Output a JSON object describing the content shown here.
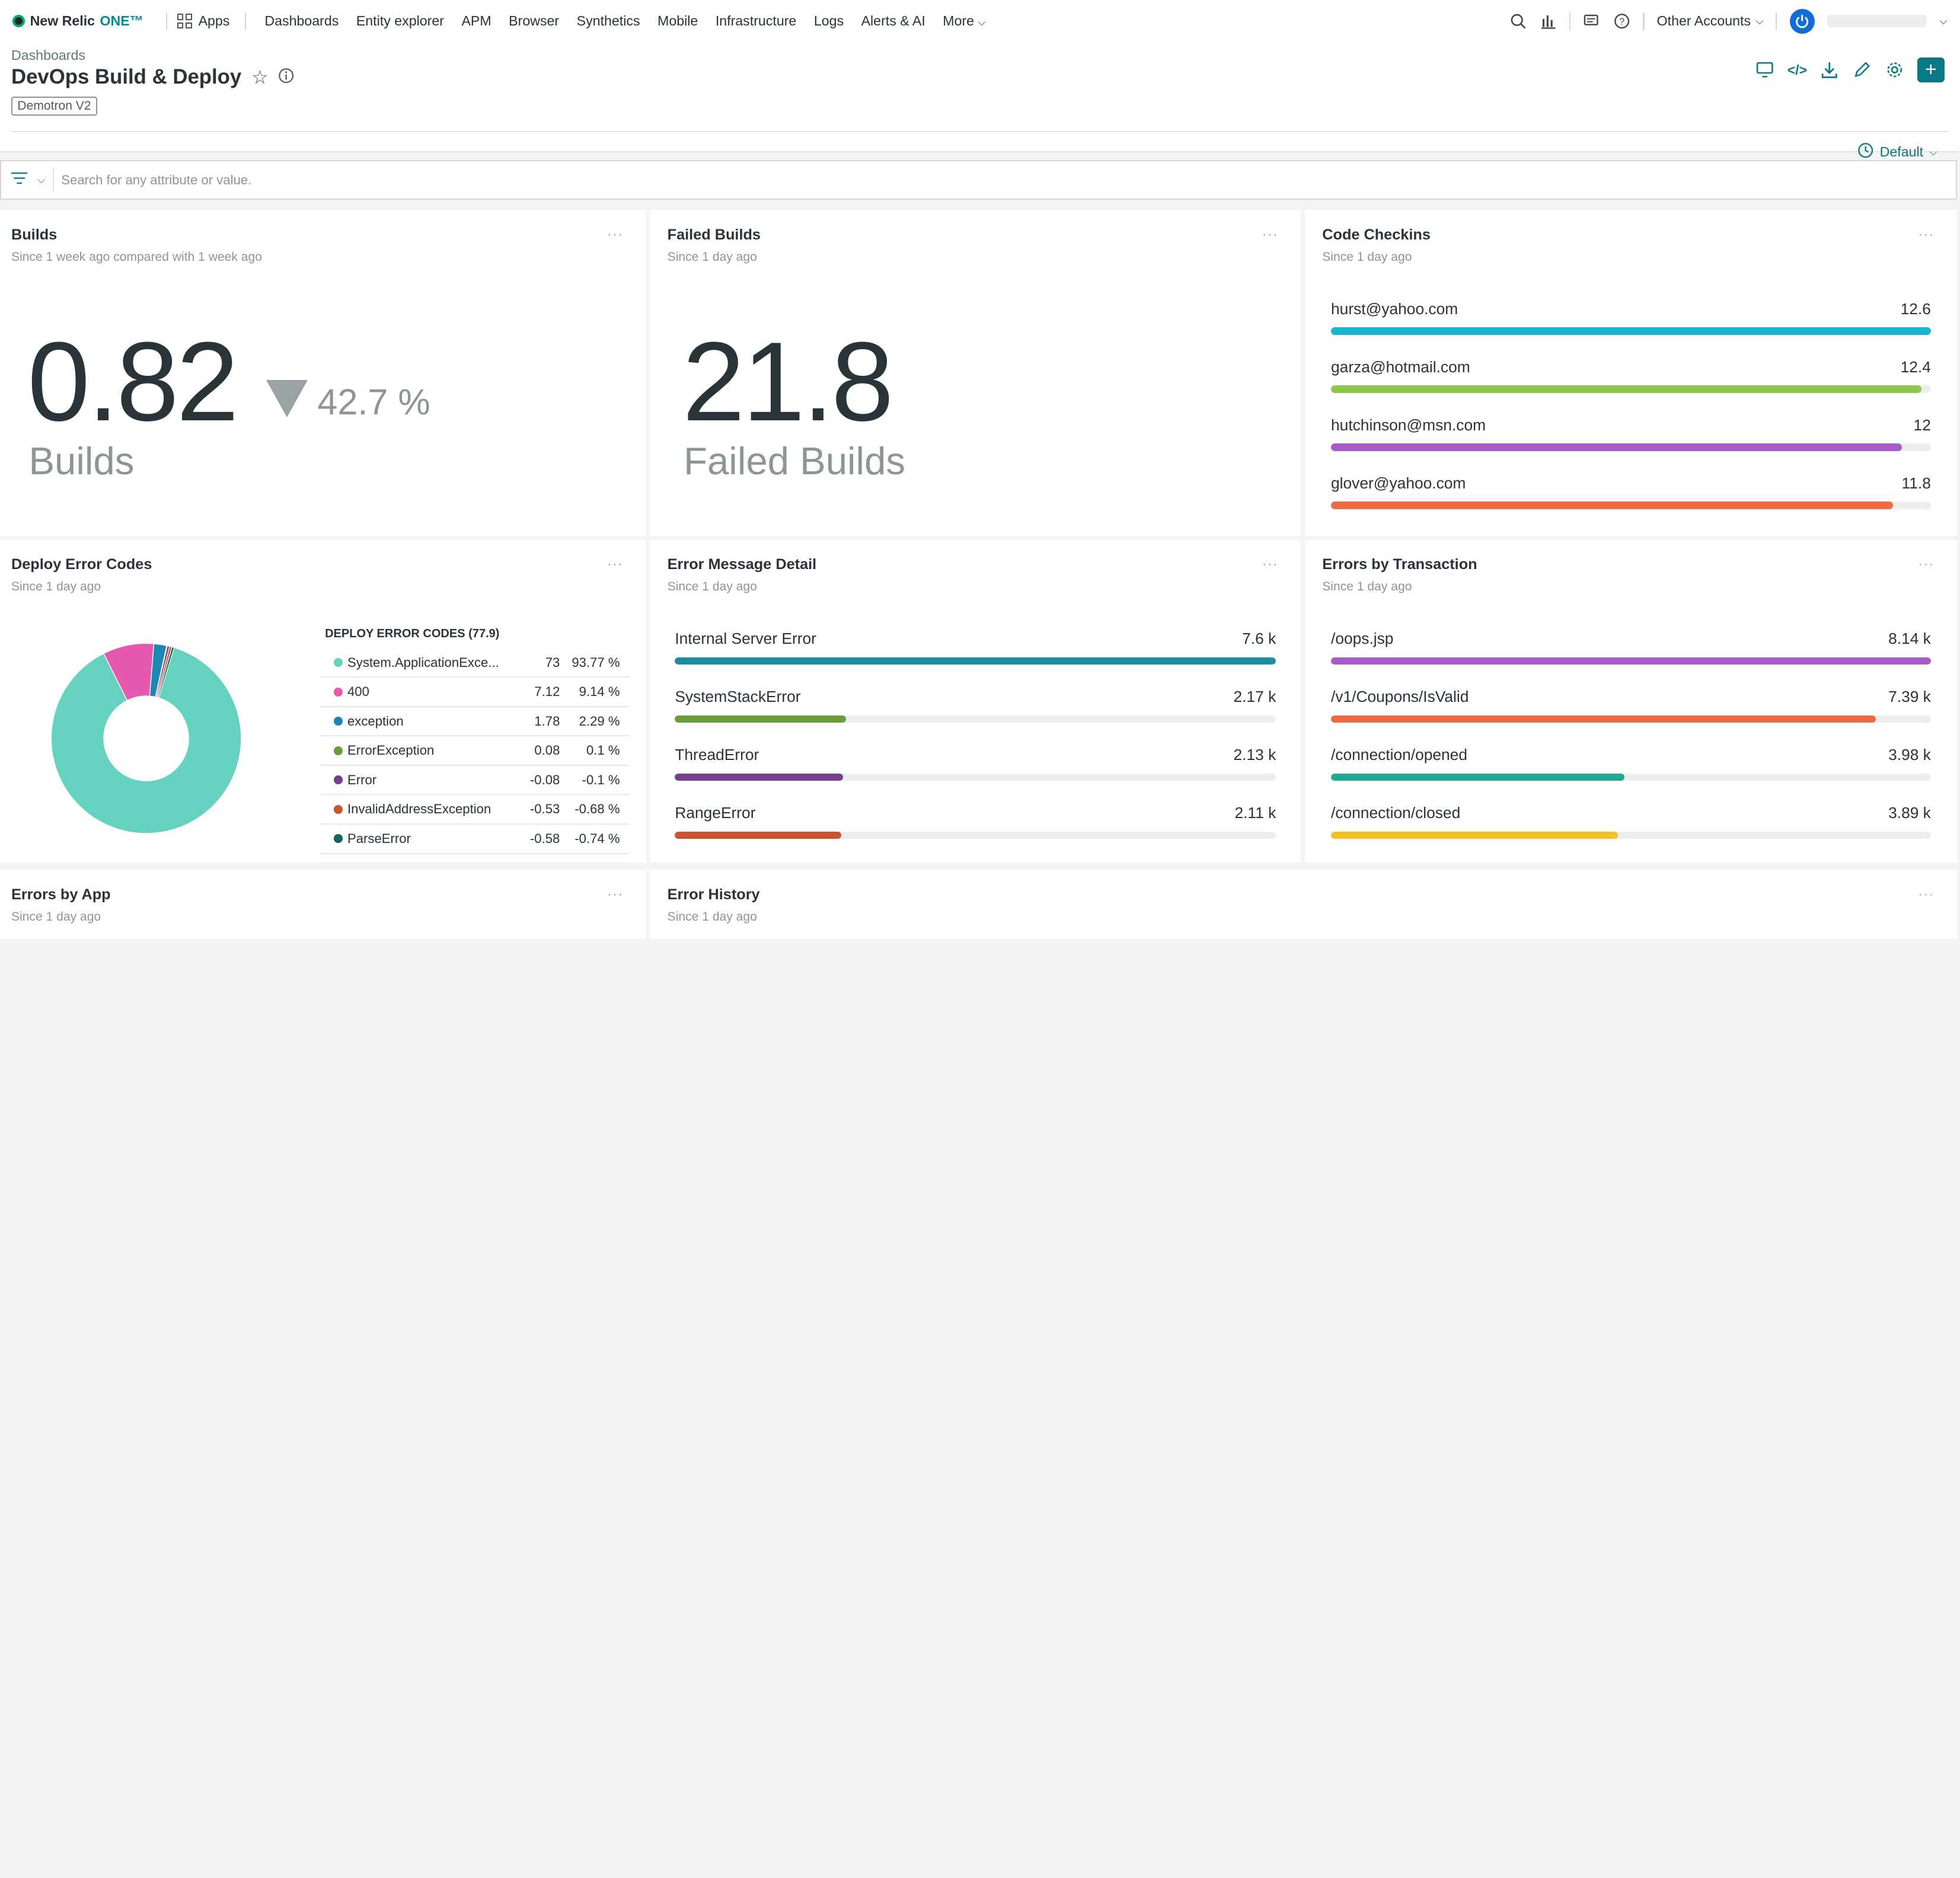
{
  "nav": {
    "logo_text": "New Relic",
    "logo_one": "ONE™",
    "apps_label": "Apps",
    "items": [
      "Dashboards",
      "Entity explorer",
      "APM",
      "Browser",
      "Synthetics",
      "Mobile",
      "Infrastructure",
      "Logs",
      "Alerts & AI",
      "More"
    ],
    "account_label": "Other Accounts"
  },
  "header": {
    "breadcrumb": "Dashboards",
    "title": "DevOps Build & Deploy",
    "tag": "Demotron V2",
    "time_label": "Default"
  },
  "filter": {
    "placeholder": "Search for any attribute or value."
  },
  "widgets": {
    "builds": {
      "title": "Builds",
      "subtitle": "Since 1 week ago compared with 1 week ago",
      "value": "0.82",
      "label": "Builds",
      "change": "42.7 %"
    },
    "failed": {
      "title": "Failed Builds",
      "subtitle": "Since 1 day ago",
      "value": "21.8",
      "label": "Failed Builds"
    },
    "checkins": {
      "title": "Code Checkins",
      "subtitle": "Since 1 day ago",
      "rows": [
        {
          "label": "hurst@yahoo.com",
          "value": "12.6",
          "fill": 1.0,
          "color": "#1ab4d3"
        },
        {
          "label": "garza@hotmail.com",
          "value": "12.4",
          "fill": 0.984,
          "color": "#8cc94a"
        },
        {
          "label": "hutchinson@msn.com",
          "value": "12",
          "fill": 0.952,
          "color": "#a65bc9"
        },
        {
          "label": "glover@yahoo.com",
          "value": "11.8",
          "fill": 0.937,
          "color": "#f06a3f"
        }
      ]
    },
    "deploy": {
      "title": "Deploy Error Codes",
      "subtitle": "Since 1 day ago",
      "table_title": "DEPLOY ERROR CODES (77.9)",
      "rows": [
        {
          "name": "System.ApplicationExce...",
          "v": "73",
          "p": "93.77 %",
          "color": "#65d2bf"
        },
        {
          "name": "400",
          "v": "7.12",
          "p": "9.14 %",
          "color": "#e55aaf"
        },
        {
          "name": "exception",
          "v": "1.78",
          "p": "2.29 %",
          "color": "#1d87b3"
        },
        {
          "name": "ErrorException",
          "v": "0.08",
          "p": "0.1 %",
          "color": "#6a9d3b"
        },
        {
          "name": "Error",
          "v": "-0.08",
          "p": "-0.1 %",
          "color": "#743f8b"
        },
        {
          "name": "InvalidAddressException",
          "v": "-0.53",
          "p": "-0.68 %",
          "color": "#c8552f"
        },
        {
          "name": "ParseError",
          "v": "-0.58",
          "p": "-0.74 %",
          "color": "#12645e"
        }
      ]
    },
    "errmsg": {
      "title": "Error Message Detail",
      "subtitle": "Since 1 day ago",
      "rows": [
        {
          "label": "Internal Server Error",
          "value": "7.6 k",
          "fill": 1.0,
          "color": "#1a8fa3"
        },
        {
          "label": "SystemStackError",
          "value": "2.17 k",
          "fill": 0.285,
          "color": "#6a9d3b"
        },
        {
          "label": "ThreadError",
          "value": "2.13 k",
          "fill": 0.28,
          "color": "#743f8b"
        },
        {
          "label": "RangeError",
          "value": "2.11 k",
          "fill": 0.277,
          "color": "#c8552f"
        }
      ]
    },
    "errtx": {
      "title": "Errors by Transaction",
      "subtitle": "Since 1 day ago",
      "rows": [
        {
          "label": "/oops.jsp",
          "value": "8.14 k",
          "fill": 1.0,
          "color": "#a65bc9"
        },
        {
          "label": "/v1/Coupons/IsValid",
          "value": "7.39 k",
          "fill": 0.908,
          "color": "#f06a3f"
        },
        {
          "label": "/connection/opened",
          "value": "3.98 k",
          "fill": 0.489,
          "color": "#1fa98f"
        },
        {
          "label": "/connection/closed",
          "value": "3.89 k",
          "fill": 0.478,
          "color": "#f5c026"
        }
      ]
    },
    "errapp": {
      "title": "Errors by App",
      "subtitle": "Since 1 day ago"
    },
    "errhist": {
      "title": "Error History",
      "subtitle": "Since 1 day ago"
    }
  },
  "chart_data": {
    "type": "pie",
    "title": "DEPLOY ERROR CODES (77.9)",
    "categories": [
      "System.ApplicationExce...",
      "400",
      "exception",
      "ErrorException",
      "Error",
      "InvalidAddressException",
      "ParseError"
    ],
    "values": [
      73,
      7.12,
      1.78,
      0.08,
      -0.08,
      -0.53,
      -0.58
    ],
    "colors": [
      "#65d2bf",
      "#e55aaf",
      "#1d87b3",
      "#6a9d3b",
      "#743f8b",
      "#c8552f",
      "#12645e"
    ]
  }
}
